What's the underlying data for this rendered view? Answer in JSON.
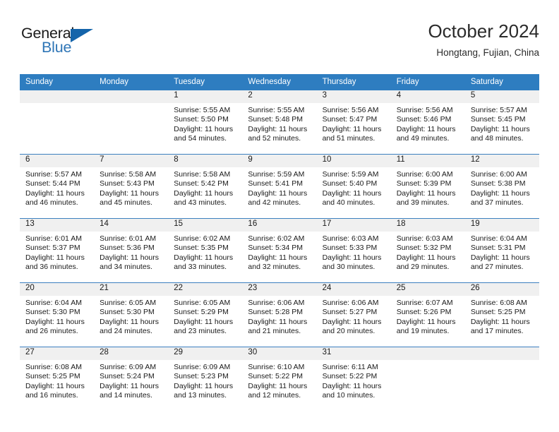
{
  "brand": {
    "name_part1": "General",
    "name_part2": "Blue",
    "triangle_icon": "triangle-icon"
  },
  "header": {
    "title": "October 2024",
    "subtitle": "Hongtang, Fujian, China"
  },
  "colors": {
    "header_blue": "#2E7DC0",
    "grid_line_blue": "#3C7FBF",
    "date_band_gray": "#F0F0F0",
    "brand_blue": "#2E75B6",
    "triangle_blue": "#1464AA",
    "text": "#1A1A1A"
  },
  "weekdays": [
    "Sunday",
    "Monday",
    "Tuesday",
    "Wednesday",
    "Thursday",
    "Friday",
    "Saturday"
  ],
  "labels": {
    "sunrise_prefix": "Sunrise:",
    "sunset_prefix": "Sunset:",
    "daylight_prefix": "Daylight:"
  },
  "weeks": [
    [
      {
        "blank": true,
        "date": "",
        "sunrise": "",
        "sunset": "",
        "daylight_line1": "",
        "daylight_line2": ""
      },
      {
        "blank": true,
        "date": "",
        "sunrise": "",
        "sunset": "",
        "daylight_line1": "",
        "daylight_line2": ""
      },
      {
        "blank": false,
        "date": "1",
        "sunrise": "Sunrise: 5:55 AM",
        "sunset": "Sunset: 5:50 PM",
        "daylight_line1": "Daylight: 11 hours",
        "daylight_line2": "and 54 minutes."
      },
      {
        "blank": false,
        "date": "2",
        "sunrise": "Sunrise: 5:55 AM",
        "sunset": "Sunset: 5:48 PM",
        "daylight_line1": "Daylight: 11 hours",
        "daylight_line2": "and 52 minutes."
      },
      {
        "blank": false,
        "date": "3",
        "sunrise": "Sunrise: 5:56 AM",
        "sunset": "Sunset: 5:47 PM",
        "daylight_line1": "Daylight: 11 hours",
        "daylight_line2": "and 51 minutes."
      },
      {
        "blank": false,
        "date": "4",
        "sunrise": "Sunrise: 5:56 AM",
        "sunset": "Sunset: 5:46 PM",
        "daylight_line1": "Daylight: 11 hours",
        "daylight_line2": "and 49 minutes."
      },
      {
        "blank": false,
        "date": "5",
        "sunrise": "Sunrise: 5:57 AM",
        "sunset": "Sunset: 5:45 PM",
        "daylight_line1": "Daylight: 11 hours",
        "daylight_line2": "and 48 minutes."
      }
    ],
    [
      {
        "blank": false,
        "date": "6",
        "sunrise": "Sunrise: 5:57 AM",
        "sunset": "Sunset: 5:44 PM",
        "daylight_line1": "Daylight: 11 hours",
        "daylight_line2": "and 46 minutes."
      },
      {
        "blank": false,
        "date": "7",
        "sunrise": "Sunrise: 5:58 AM",
        "sunset": "Sunset: 5:43 PM",
        "daylight_line1": "Daylight: 11 hours",
        "daylight_line2": "and 45 minutes."
      },
      {
        "blank": false,
        "date": "8",
        "sunrise": "Sunrise: 5:58 AM",
        "sunset": "Sunset: 5:42 PM",
        "daylight_line1": "Daylight: 11 hours",
        "daylight_line2": "and 43 minutes."
      },
      {
        "blank": false,
        "date": "9",
        "sunrise": "Sunrise: 5:59 AM",
        "sunset": "Sunset: 5:41 PM",
        "daylight_line1": "Daylight: 11 hours",
        "daylight_line2": "and 42 minutes."
      },
      {
        "blank": false,
        "date": "10",
        "sunrise": "Sunrise: 5:59 AM",
        "sunset": "Sunset: 5:40 PM",
        "daylight_line1": "Daylight: 11 hours",
        "daylight_line2": "and 40 minutes."
      },
      {
        "blank": false,
        "date": "11",
        "sunrise": "Sunrise: 6:00 AM",
        "sunset": "Sunset: 5:39 PM",
        "daylight_line1": "Daylight: 11 hours",
        "daylight_line2": "and 39 minutes."
      },
      {
        "blank": false,
        "date": "12",
        "sunrise": "Sunrise: 6:00 AM",
        "sunset": "Sunset: 5:38 PM",
        "daylight_line1": "Daylight: 11 hours",
        "daylight_line2": "and 37 minutes."
      }
    ],
    [
      {
        "blank": false,
        "date": "13",
        "sunrise": "Sunrise: 6:01 AM",
        "sunset": "Sunset: 5:37 PM",
        "daylight_line1": "Daylight: 11 hours",
        "daylight_line2": "and 36 minutes."
      },
      {
        "blank": false,
        "date": "14",
        "sunrise": "Sunrise: 6:01 AM",
        "sunset": "Sunset: 5:36 PM",
        "daylight_line1": "Daylight: 11 hours",
        "daylight_line2": "and 34 minutes."
      },
      {
        "blank": false,
        "date": "15",
        "sunrise": "Sunrise: 6:02 AM",
        "sunset": "Sunset: 5:35 PM",
        "daylight_line1": "Daylight: 11 hours",
        "daylight_line2": "and 33 minutes."
      },
      {
        "blank": false,
        "date": "16",
        "sunrise": "Sunrise: 6:02 AM",
        "sunset": "Sunset: 5:34 PM",
        "daylight_line1": "Daylight: 11 hours",
        "daylight_line2": "and 32 minutes."
      },
      {
        "blank": false,
        "date": "17",
        "sunrise": "Sunrise: 6:03 AM",
        "sunset": "Sunset: 5:33 PM",
        "daylight_line1": "Daylight: 11 hours",
        "daylight_line2": "and 30 minutes."
      },
      {
        "blank": false,
        "date": "18",
        "sunrise": "Sunrise: 6:03 AM",
        "sunset": "Sunset: 5:32 PM",
        "daylight_line1": "Daylight: 11 hours",
        "daylight_line2": "and 29 minutes."
      },
      {
        "blank": false,
        "date": "19",
        "sunrise": "Sunrise: 6:04 AM",
        "sunset": "Sunset: 5:31 PM",
        "daylight_line1": "Daylight: 11 hours",
        "daylight_line2": "and 27 minutes."
      }
    ],
    [
      {
        "blank": false,
        "date": "20",
        "sunrise": "Sunrise: 6:04 AM",
        "sunset": "Sunset: 5:30 PM",
        "daylight_line1": "Daylight: 11 hours",
        "daylight_line2": "and 26 minutes."
      },
      {
        "blank": false,
        "date": "21",
        "sunrise": "Sunrise: 6:05 AM",
        "sunset": "Sunset: 5:30 PM",
        "daylight_line1": "Daylight: 11 hours",
        "daylight_line2": "and 24 minutes."
      },
      {
        "blank": false,
        "date": "22",
        "sunrise": "Sunrise: 6:05 AM",
        "sunset": "Sunset: 5:29 PM",
        "daylight_line1": "Daylight: 11 hours",
        "daylight_line2": "and 23 minutes."
      },
      {
        "blank": false,
        "date": "23",
        "sunrise": "Sunrise: 6:06 AM",
        "sunset": "Sunset: 5:28 PM",
        "daylight_line1": "Daylight: 11 hours",
        "daylight_line2": "and 21 minutes."
      },
      {
        "blank": false,
        "date": "24",
        "sunrise": "Sunrise: 6:06 AM",
        "sunset": "Sunset: 5:27 PM",
        "daylight_line1": "Daylight: 11 hours",
        "daylight_line2": "and 20 minutes."
      },
      {
        "blank": false,
        "date": "25",
        "sunrise": "Sunrise: 6:07 AM",
        "sunset": "Sunset: 5:26 PM",
        "daylight_line1": "Daylight: 11 hours",
        "daylight_line2": "and 19 minutes."
      },
      {
        "blank": false,
        "date": "26",
        "sunrise": "Sunrise: 6:08 AM",
        "sunset": "Sunset: 5:25 PM",
        "daylight_line1": "Daylight: 11 hours",
        "daylight_line2": "and 17 minutes."
      }
    ],
    [
      {
        "blank": false,
        "date": "27",
        "sunrise": "Sunrise: 6:08 AM",
        "sunset": "Sunset: 5:25 PM",
        "daylight_line1": "Daylight: 11 hours",
        "daylight_line2": "and 16 minutes."
      },
      {
        "blank": false,
        "date": "28",
        "sunrise": "Sunrise: 6:09 AM",
        "sunset": "Sunset: 5:24 PM",
        "daylight_line1": "Daylight: 11 hours",
        "daylight_line2": "and 14 minutes."
      },
      {
        "blank": false,
        "date": "29",
        "sunrise": "Sunrise: 6:09 AM",
        "sunset": "Sunset: 5:23 PM",
        "daylight_line1": "Daylight: 11 hours",
        "daylight_line2": "and 13 minutes."
      },
      {
        "blank": false,
        "date": "30",
        "sunrise": "Sunrise: 6:10 AM",
        "sunset": "Sunset: 5:22 PM",
        "daylight_line1": "Daylight: 11 hours",
        "daylight_line2": "and 12 minutes."
      },
      {
        "blank": false,
        "date": "31",
        "sunrise": "Sunrise: 6:11 AM",
        "sunset": "Sunset: 5:22 PM",
        "daylight_line1": "Daylight: 11 hours",
        "daylight_line2": "and 10 minutes."
      },
      {
        "blank": true,
        "date": "",
        "sunrise": "",
        "sunset": "",
        "daylight_line1": "",
        "daylight_line2": ""
      },
      {
        "blank": true,
        "date": "",
        "sunrise": "",
        "sunset": "",
        "daylight_line1": "",
        "daylight_line2": ""
      }
    ]
  ]
}
